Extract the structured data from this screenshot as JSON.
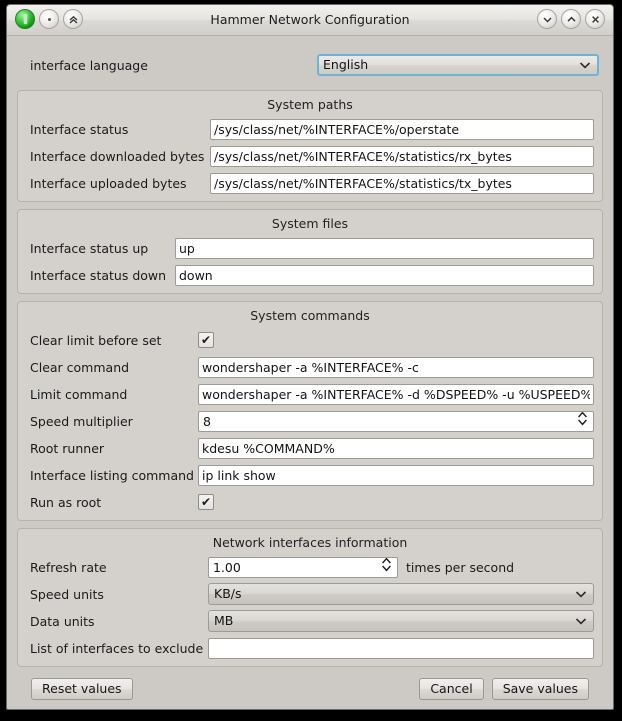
{
  "window": {
    "title": "Hammer Network Configuration",
    "app_icon": "network-monitor-icon",
    "titlebar_buttons": {
      "shade": "chevron-double-up-icon",
      "menu": "dot-icon",
      "minimize": "chevron-down-icon",
      "maximize": "chevron-up-icon",
      "close": "close-x-icon"
    }
  },
  "language": {
    "label": "interface language",
    "value": "English"
  },
  "system_paths": {
    "title": "System paths",
    "rows": [
      {
        "label": "Interface status",
        "value": "/sys/class/net/%INTERFACE%/operstate"
      },
      {
        "label": "Interface downloaded bytes",
        "value": "/sys/class/net/%INTERFACE%/statistics/rx_bytes"
      },
      {
        "label": "Interface uploaded bytes",
        "value": "/sys/class/net/%INTERFACE%/statistics/tx_bytes"
      }
    ]
  },
  "system_files": {
    "title": "System files",
    "rows": [
      {
        "label": "Interface status up",
        "value": "up"
      },
      {
        "label": "Interface status down",
        "value": "down"
      }
    ]
  },
  "system_commands": {
    "title": "System commands",
    "clear_limit_label": "Clear limit before set",
    "clear_limit_checked": "✔",
    "clear_command_label": "Clear command",
    "clear_command_value": "wondershaper -a %INTERFACE% -c",
    "limit_command_label": "Limit command",
    "limit_command_value": "wondershaper -a %INTERFACE% -d %DSPEED% -u %USPEED%",
    "speed_multiplier_label": "Speed multiplier",
    "speed_multiplier_value": "8",
    "root_runner_label": "Root runner",
    "root_runner_value": "kdesu %COMMAND%",
    "listing_label": "Interface listing command",
    "listing_value": "ip link show",
    "run_as_root_label": "Run as root",
    "run_as_root_checked": "✔"
  },
  "network_info": {
    "title": "Network interfaces information",
    "refresh_label": "Refresh rate",
    "refresh_value": "1.00",
    "refresh_suffix": "times per second",
    "speed_units_label": "Speed units",
    "speed_units_value": "KB/s",
    "data_units_label": "Data units",
    "data_units_value": "MB",
    "exclude_label": "List of interfaces to exclude",
    "exclude_value": ""
  },
  "footer": {
    "reset": "Reset values",
    "cancel": "Cancel",
    "save": "Save values"
  }
}
